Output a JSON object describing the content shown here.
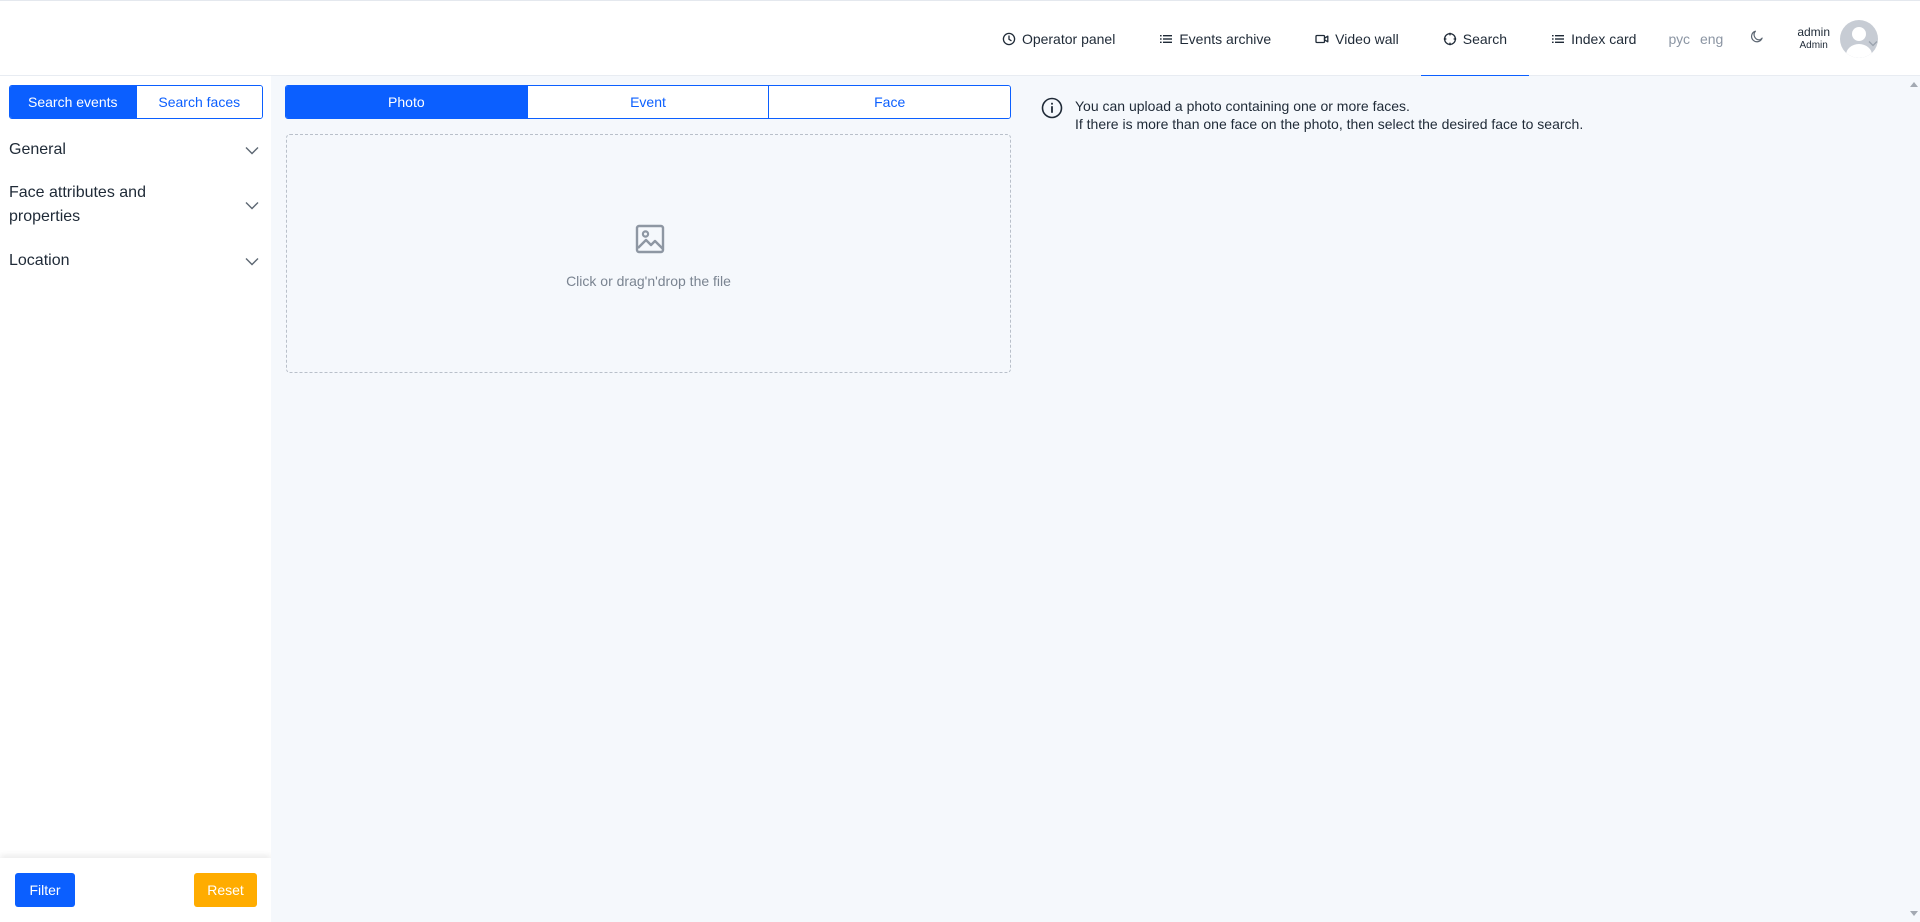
{
  "header": {
    "nav": [
      {
        "label": "Operator panel",
        "icon": "clock-icon"
      },
      {
        "label": "Events archive",
        "icon": "list-icon"
      },
      {
        "label": "Video wall",
        "icon": "video-camera-icon"
      },
      {
        "label": "Search",
        "icon": "crosshair-icon",
        "active": true
      },
      {
        "label": "Index card",
        "icon": "list-icon"
      }
    ],
    "languages": [
      "рус",
      "eng"
    ],
    "theme_toggle_icon": "moon-icon",
    "user": {
      "name": "admin",
      "role": "Admin"
    }
  },
  "sidebar": {
    "search_tabs": [
      {
        "label": "Search events",
        "active": true
      },
      {
        "label": "Search faces",
        "active": false
      }
    ],
    "sections": [
      {
        "label": "General"
      },
      {
        "label": "Face attributes and properties"
      },
      {
        "label": "Location"
      }
    ],
    "filter_label": "Filter",
    "reset_label": "Reset"
  },
  "main": {
    "source_tabs": [
      {
        "label": "Photo",
        "active": true
      },
      {
        "label": "Event",
        "active": false
      },
      {
        "label": "Face",
        "active": false
      }
    ],
    "dropzone_text": "Click or drag'n'drop the file",
    "info_lines": [
      "You can upload a photo containing one or more faces.",
      "If there is more than one face on the photo, then select the desired face to search."
    ]
  },
  "colors": {
    "accent": "#0b5fff",
    "reset": "#ffac00",
    "main_bg": "#f5f8fc"
  }
}
